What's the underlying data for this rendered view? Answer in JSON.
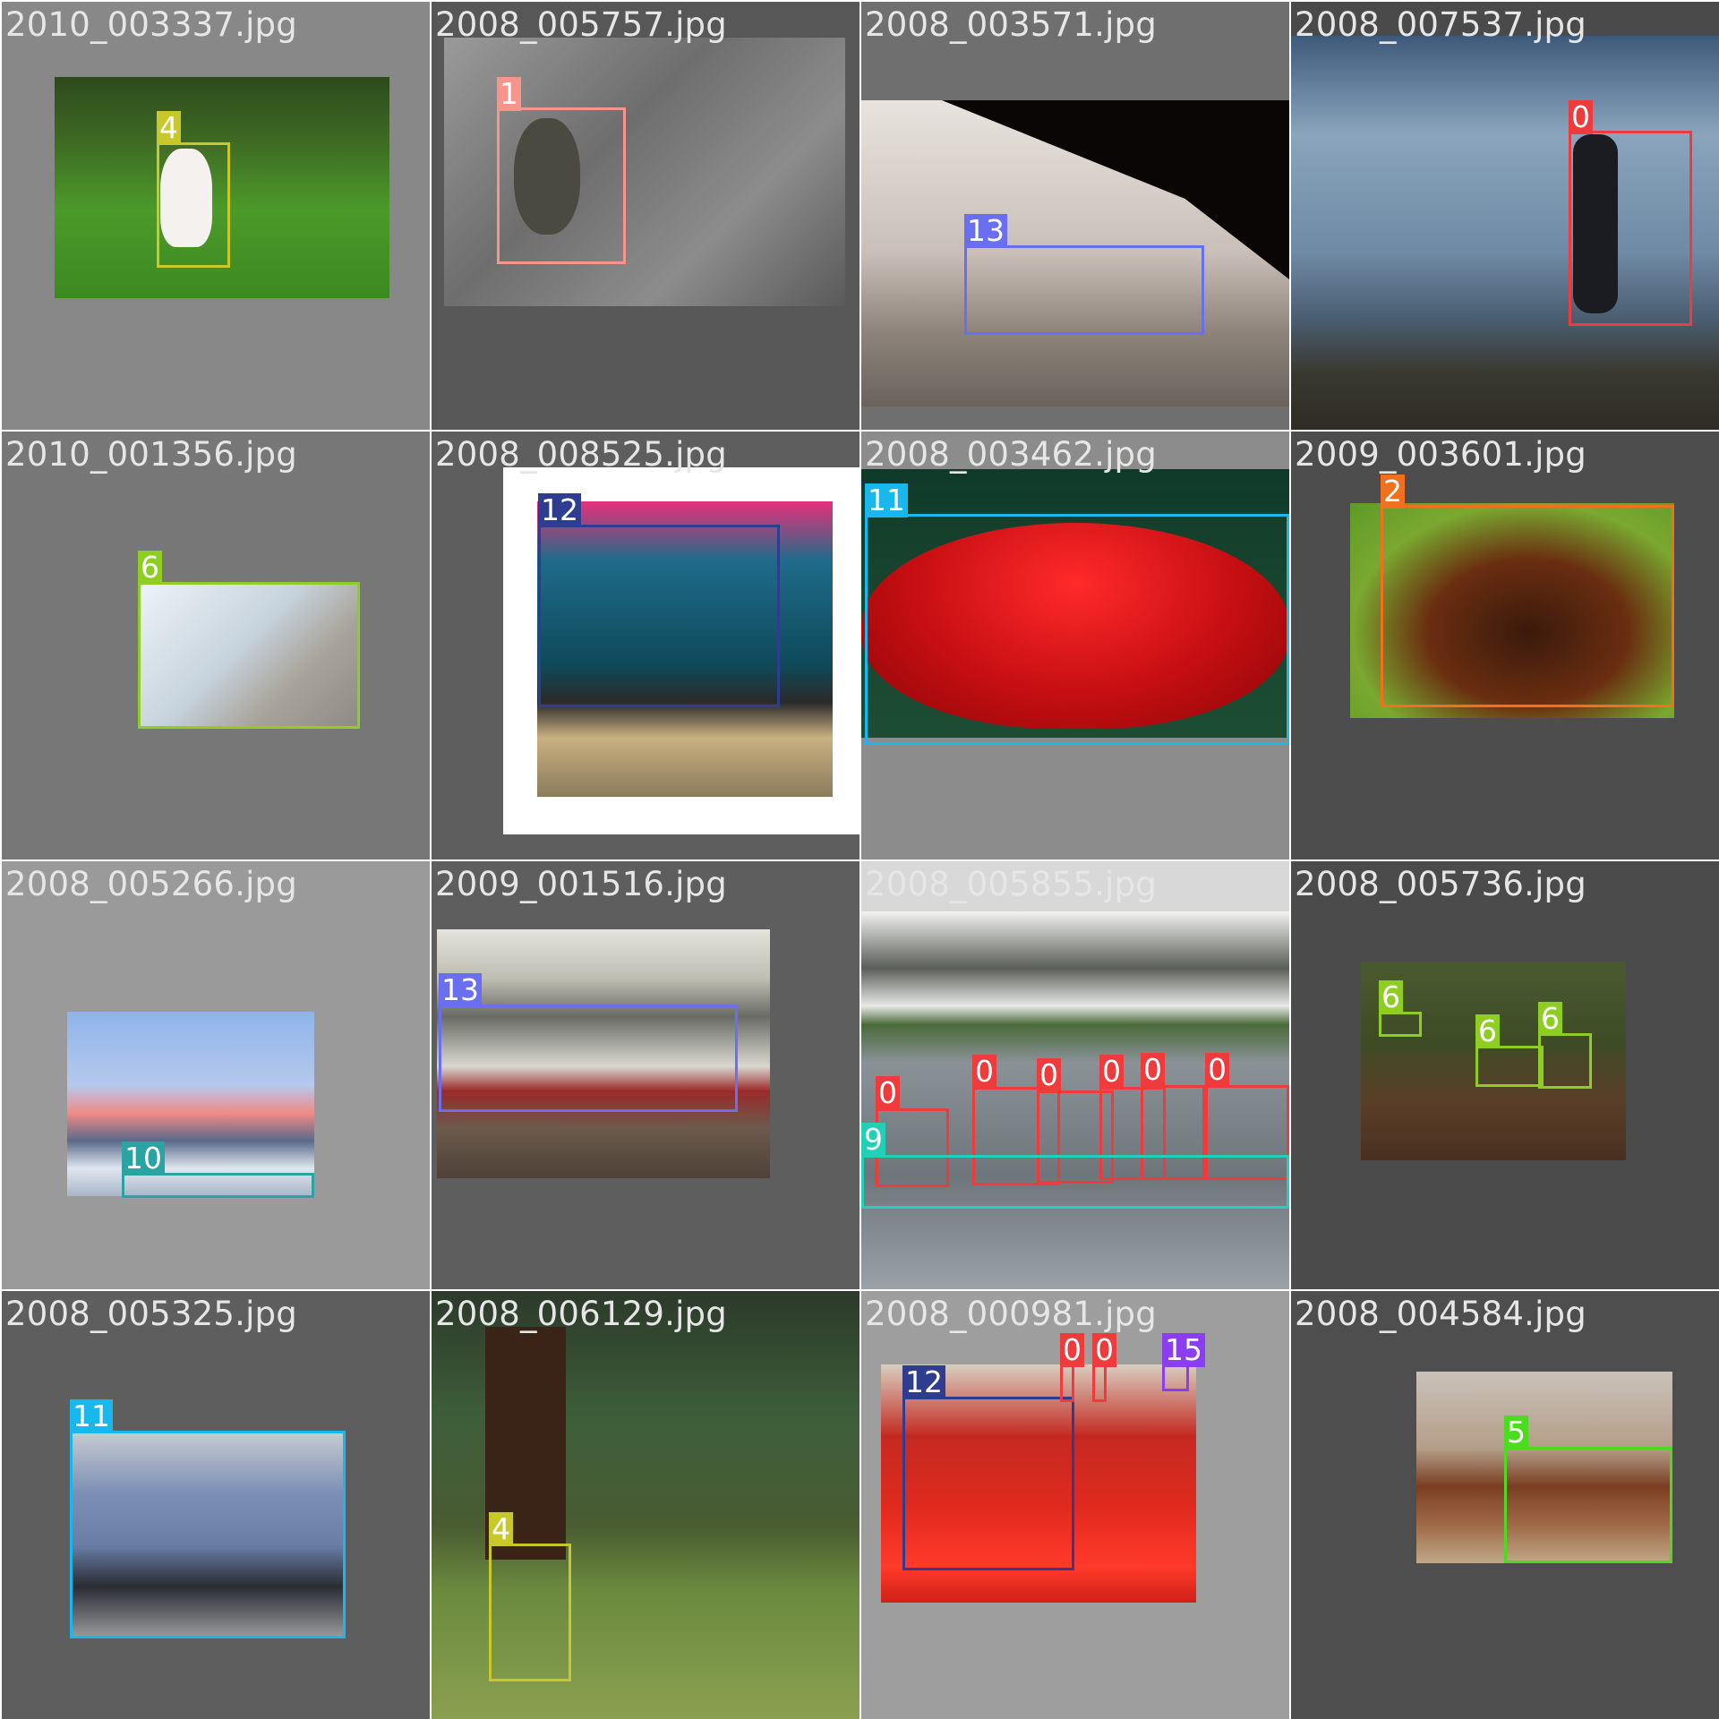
{
  "mosaic": {
    "cells": [
      {
        "file": "2010_003337.jpg",
        "boxes": [
          {
            "label": "4",
            "color": "#c8c82a"
          }
        ]
      },
      {
        "file": "2008_005757.jpg",
        "boxes": [
          {
            "label": "1",
            "color": "#f7958c"
          }
        ]
      },
      {
        "file": "2008_003571.jpg",
        "boxes": [
          {
            "label": "13",
            "color": "#6a6ef0"
          }
        ]
      },
      {
        "file": "2008_007537.jpg",
        "boxes": [
          {
            "label": "0",
            "color": "#ef3b3b"
          }
        ]
      },
      {
        "file": "2010_001356.jpg",
        "boxes": [
          {
            "label": "6",
            "color": "#8ecd22"
          }
        ]
      },
      {
        "file": "2008_008525.jpg",
        "boxes": [
          {
            "label": "12",
            "color": "#2e3d8f"
          }
        ]
      },
      {
        "file": "2008_003462.jpg",
        "boxes": [
          {
            "label": "11",
            "color": "#18b8ef"
          }
        ]
      },
      {
        "file": "2009_003601.jpg",
        "boxes": [
          {
            "label": "2",
            "color": "#f07020"
          }
        ]
      },
      {
        "file": "2008_005266.jpg",
        "boxes": [
          {
            "label": "10",
            "color": "#2aa3a3"
          }
        ]
      },
      {
        "file": "2009_001516.jpg",
        "boxes": [
          {
            "label": "13",
            "color": "#6a6ef0"
          }
        ]
      },
      {
        "file": "2008_005855.jpg",
        "boxes": [
          {
            "label": "0",
            "color": "#ef3b3b"
          },
          {
            "label": "0",
            "color": "#ef3b3b"
          },
          {
            "label": "0",
            "color": "#ef3b3b"
          },
          {
            "label": "0",
            "color": "#ef3b3b"
          },
          {
            "label": "0",
            "color": "#ef3b3b"
          },
          {
            "label": "0",
            "color": "#ef3b3b"
          },
          {
            "label": "9",
            "color": "#22d0b8"
          }
        ]
      },
      {
        "file": "2008_005736.jpg",
        "boxes": [
          {
            "label": "6",
            "color": "#8ecd22"
          },
          {
            "label": "6",
            "color": "#8ecd22"
          },
          {
            "label": "6",
            "color": "#8ecd22"
          }
        ]
      },
      {
        "file": "2008_005325.jpg",
        "boxes": [
          {
            "label": "11",
            "color": "#18b8ef"
          }
        ]
      },
      {
        "file": "2008_006129.jpg",
        "boxes": [
          {
            "label": "4",
            "color": "#c8c82a"
          }
        ]
      },
      {
        "file": "2008_000981.jpg",
        "boxes": [
          {
            "label": "12",
            "color": "#2e3d8f"
          },
          {
            "label": "0",
            "color": "#ef3b3b"
          },
          {
            "label": "0",
            "color": "#ef3b3b"
          },
          {
            "label": "15",
            "color": "#8a3ef0"
          }
        ]
      },
      {
        "file": "2008_004584.jpg",
        "boxes": [
          {
            "label": "5",
            "color": "#4bdc20"
          }
        ]
      }
    ]
  }
}
